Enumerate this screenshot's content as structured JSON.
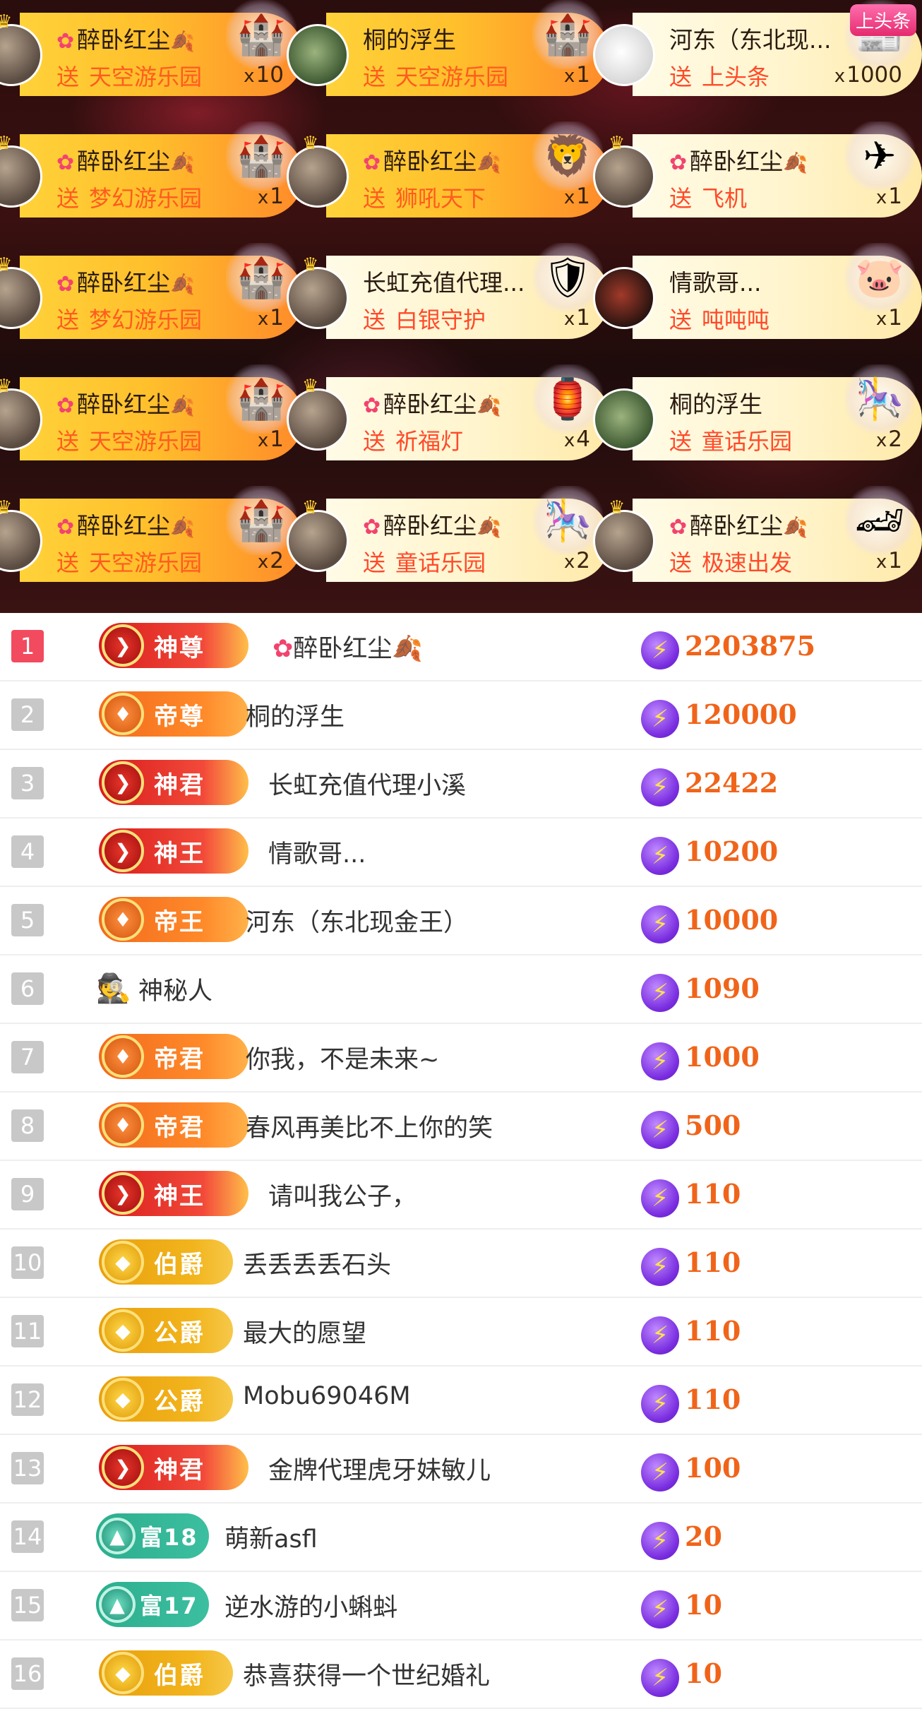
{
  "gifts": [
    {
      "user": "醉卧红尘",
      "decor": true,
      "action": "送",
      "gift": "天空游乐园",
      "count": "10",
      "style": "hot",
      "icon": "castle-icon",
      "avatar": "default"
    },
    {
      "user": "桐的浮生",
      "decor": false,
      "action": "送",
      "gift": "天空游乐园",
      "count": "1",
      "style": "hot",
      "icon": "castle-icon",
      "avatar": "green"
    },
    {
      "user": "河东（东北现...",
      "decor": false,
      "action": "送",
      "gift": "上头条",
      "count": "1000",
      "style": "plain",
      "icon": "headline-icon",
      "avatar": "white",
      "badge": "上头条"
    },
    {
      "user": "醉卧红尘",
      "decor": true,
      "action": "送",
      "gift": "梦幻游乐园",
      "count": "1",
      "style": "hot",
      "icon": "castle-icon",
      "avatar": "default"
    },
    {
      "user": "醉卧红尘",
      "decor": true,
      "action": "送",
      "gift": "狮吼天下",
      "count": "1",
      "style": "hot",
      "icon": "lion-icon",
      "avatar": "default"
    },
    {
      "user": "醉卧红尘",
      "decor": true,
      "action": "送",
      "gift": "飞机",
      "count": "1",
      "style": "plain",
      "icon": "airplane-icon",
      "avatar": "default"
    },
    {
      "user": "醉卧红尘",
      "decor": true,
      "action": "送",
      "gift": "梦幻游乐园",
      "count": "1",
      "style": "hot",
      "icon": "castle-icon",
      "avatar": "default"
    },
    {
      "user": "长虹充值代理...",
      "decor": false,
      "action": "送",
      "gift": "白银守护",
      "count": "1",
      "style": "plain",
      "icon": "shield-icon",
      "avatar": "default"
    },
    {
      "user": "情歌哥...",
      "decor": false,
      "action": "送",
      "gift": "吨吨吨",
      "count": "1",
      "style": "plain",
      "icon": "pig-icon",
      "avatar": "dark"
    },
    {
      "user": "醉卧红尘",
      "decor": true,
      "action": "送",
      "gift": "天空游乐园",
      "count": "1",
      "style": "hot",
      "icon": "castle-icon",
      "avatar": "default"
    },
    {
      "user": "醉卧红尘",
      "decor": true,
      "action": "送",
      "gift": "祈福灯",
      "count": "4",
      "style": "plain",
      "icon": "lantern-icon",
      "avatar": "default"
    },
    {
      "user": "桐的浮生",
      "decor": false,
      "action": "送",
      "gift": "童话乐园",
      "count": "2",
      "style": "plain",
      "icon": "carousel-horse-icon",
      "avatar": "green"
    },
    {
      "user": "醉卧红尘",
      "decor": true,
      "action": "送",
      "gift": "天空游乐园",
      "count": "2",
      "style": "hot",
      "icon": "castle-icon",
      "avatar": "default"
    },
    {
      "user": "醉卧红尘",
      "decor": true,
      "action": "送",
      "gift": "童话乐园",
      "count": "2",
      "style": "plain",
      "icon": "carousel-horse-icon",
      "avatar": "default"
    },
    {
      "user": "醉卧红尘",
      "decor": true,
      "action": "送",
      "gift": "极速出发",
      "count": "1",
      "style": "plain",
      "icon": "sports-car-icon",
      "avatar": "default"
    }
  ],
  "count_prefix": "x",
  "ranking": [
    {
      "rank": "1",
      "level": "神尊",
      "tier": "red",
      "user": "醉卧红尘",
      "decor": true,
      "score": "2203875"
    },
    {
      "rank": "2",
      "level": "帝尊",
      "tier": "orange",
      "user": "桐的浮生",
      "decor": false,
      "score": "120000"
    },
    {
      "rank": "3",
      "level": "神君",
      "tier": "red",
      "user": "长虹充值代理小溪",
      "decor": false,
      "score": "22422"
    },
    {
      "rank": "4",
      "level": "神王",
      "tier": "red",
      "user": "情歌哥...",
      "decor": false,
      "score": "10200"
    },
    {
      "rank": "5",
      "level": "帝王",
      "tier": "orange",
      "user": "河东（东北现金王）",
      "decor": false,
      "score": "10000"
    },
    {
      "rank": "6",
      "level": "",
      "tier": "mystery",
      "user": "神秘人",
      "decor": false,
      "score": "1090"
    },
    {
      "rank": "7",
      "level": "帝君",
      "tier": "orange",
      "user": "你我，不是未来~",
      "decor": false,
      "score": "1000"
    },
    {
      "rank": "8",
      "level": "帝君",
      "tier": "orange",
      "user": "春风再美比不上你的笑",
      "decor": false,
      "score": "500"
    },
    {
      "rank": "9",
      "level": "神王",
      "tier": "red",
      "user": "请叫我公子，",
      "decor": false,
      "score": "110"
    },
    {
      "rank": "10",
      "level": "伯爵",
      "tier": "gold",
      "user": "丢丢丢丢石头",
      "decor": false,
      "score": "110"
    },
    {
      "rank": "11",
      "level": "公爵",
      "tier": "gold",
      "user": "最大的愿望",
      "decor": false,
      "score": "110"
    },
    {
      "rank": "12",
      "level": "公爵",
      "tier": "gold",
      "user": "Mobu69046M",
      "decor": false,
      "score": "110"
    },
    {
      "rank": "13",
      "level": "神君",
      "tier": "red",
      "user": "金牌代理虎牙妹敏儿",
      "decor": false,
      "score": "100"
    },
    {
      "rank": "14",
      "level": "富18",
      "tier": "teal",
      "user": "萌新asfl",
      "decor": false,
      "score": "20"
    },
    {
      "rank": "15",
      "level": "富17",
      "tier": "teal",
      "user": "逆水游的小蝌蚪",
      "decor": false,
      "score": "10"
    },
    {
      "rank": "16",
      "level": "伯爵",
      "tier": "gold",
      "user": "恭喜获得一个世纪婚礼",
      "decor": false,
      "score": "10"
    }
  ],
  "colors": {
    "rank_first": "#f24a5e",
    "rank_other": "#c8c8c8",
    "score": "#f0641a",
    "gift_text": "#ff4a2a"
  }
}
